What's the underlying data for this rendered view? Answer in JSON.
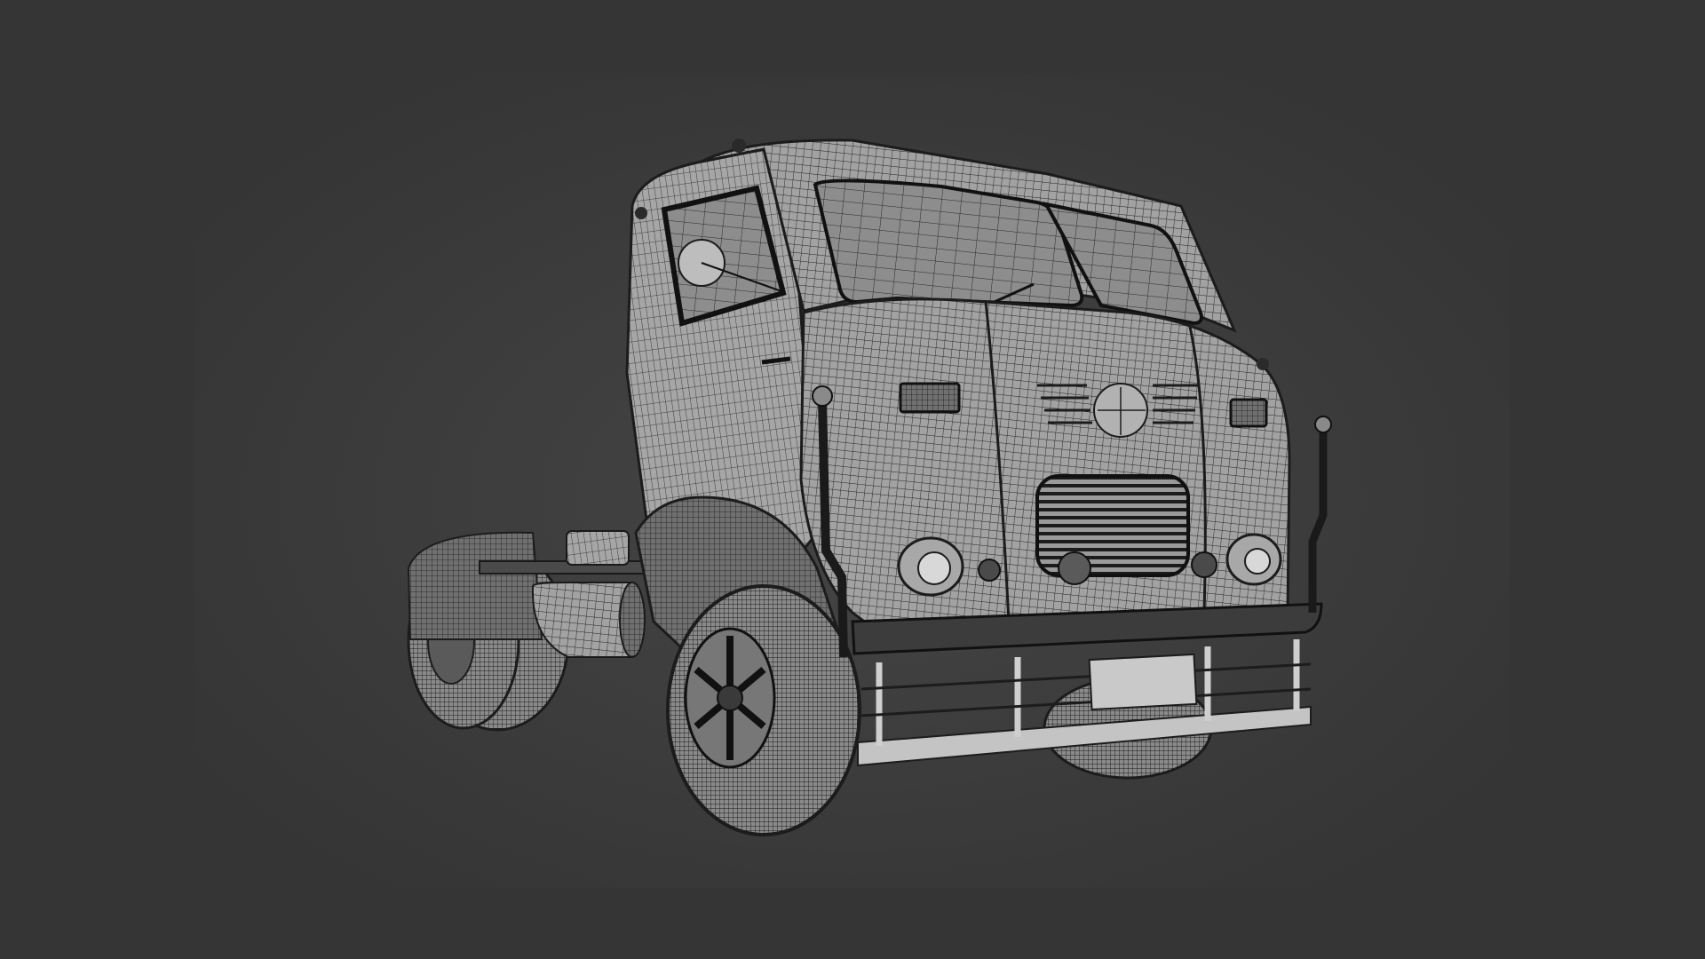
{
  "scene": {
    "subject": "wireframe-truck-render",
    "colors": {
      "background": "#353535",
      "viewport": "#3a3a3a",
      "vignette_center": "#444444",
      "mesh_fill": "#9a9a9a",
      "mesh_fill_light": "#b8b8b8",
      "mesh_fill_dark": "#6c6c6c",
      "wire": "#1e1e1e",
      "tire": "#2a2a2a",
      "chrome": "#cfcfcf",
      "plate": "#c9c9c9"
    }
  }
}
